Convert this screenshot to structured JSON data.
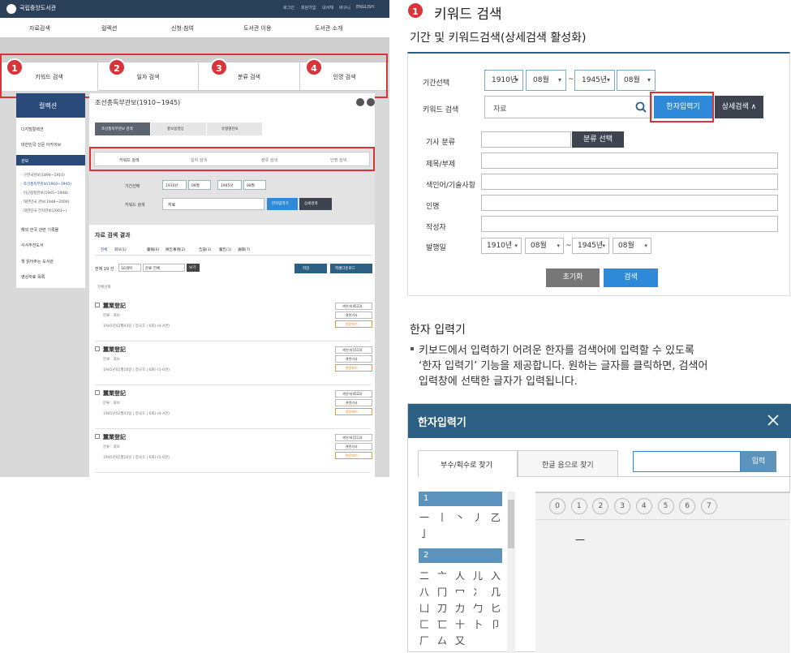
{
  "left_shot": {
    "brand": "국립중앙도서관",
    "util": [
      "로그인",
      "회원가입",
      "내서재",
      "바구니",
      "ENGLISH"
    ],
    "gnb": [
      "자료검색",
      "컬렉션",
      "신청·참여",
      "도서관 이용",
      "도서관 소개"
    ],
    "tabs": [
      {
        "num": "1",
        "label": "키워드 검색"
      },
      {
        "num": "2",
        "label": "일자 검색"
      },
      {
        "num": "3",
        "label": "분류 검색"
      },
      {
        "num": "4",
        "label": "인명 검색"
      }
    ],
    "sidebar_title": "컬렉션",
    "page_title": "조선총독부관보(1910~1945)",
    "sidebar_items": [
      "디지털컬렉션",
      "대한민국 신문 아카이브",
      "관보",
      "· 구한국관보(1894~1910)",
      "· 조선총독부관보(1910~1945)",
      "· 미군정청관보(1945~1948)",
      "· 대한민국 관보(1948~2000)",
      "· 대한민국 전자관보(2001~)",
      "해외 한국 관련 기록물",
      "사서추천도서",
      "책 읽어주는 도서관",
      "영상자료 목록"
    ],
    "sub_tabs": [
      "조선총독부관보 검색",
      "홍보용영상",
      "유형별관보"
    ],
    "inner_tabs": [
      "키워드 검색",
      "일자 검색",
      "분류 검색",
      "인명 검색"
    ],
    "period_label": "기간선택",
    "keyword_label": "키워드 검색",
    "year_from": "1910년",
    "month_from": "08월",
    "year_to": "1945년",
    "month_to": "08월",
    "keyword_value": "자료",
    "hanja_button": "한자입력기",
    "detail_button": "상세검색",
    "result_title": "자료 검색 결과",
    "result_tabs": [
      "전체",
      "휘보(1)",
      "彙報(6)",
      "條告事項(2)",
      "告諭(3)",
      "彙告(1)",
      "通牒(7)"
    ],
    "total": "전체 19 건",
    "page_size": "10개씩",
    "sort": "분류 전체",
    "view": "보기",
    "save": "저장",
    "excel": "엑셀다운로드",
    "select_all": "전체선택",
    "records": [
      {
        "title": "蠶業登記",
        "cat": "분류 : 휘보",
        "meta": "1945년02월03일 | 정규호 | 6회(-(4-4면)",
        "badges": [
          "색인어(4523)",
          "관련기사",
          "원문보기"
        ]
      },
      {
        "title": "蠶業登記",
        "cat": "분류 : 휘보",
        "meta": "1945년01월16일 | 정규호 | 6회(-(5-6면)",
        "badges": [
          "색인어(1513)",
          "관련기사",
          "원문보기"
        ]
      },
      {
        "title": "蠶業登記",
        "cat": "분류 : 휘보",
        "meta": "1945년02월03일 | 정규호 | 6회(-(4-4면)",
        "badges": [
          "색인어(4523)",
          "관련기사",
          "원문보기"
        ]
      },
      {
        "title": "蠶業登記",
        "cat": "분류 : 휘보",
        "meta": "1945년01월16일 | 정규호 | 6회(-(5-6면)",
        "badges": [
          "색인어(1513)",
          "관련기사",
          "원문보기"
        ]
      }
    ]
  },
  "section1": {
    "num": "1",
    "title": "키워드 검색",
    "subtitle": "기간 및 키워드검색(상세검색 활성화)"
  },
  "form": {
    "period_label": "기간선택",
    "keyword_label": "키워드 검색",
    "year_from": "1910년",
    "month_from": "08월",
    "sep": "~",
    "year_to": "1945년",
    "month_to": "08월",
    "keyword_value": "자료",
    "hanja_button": "한자입력기",
    "detail_button": "상세검색 ∧",
    "article_cat_label": "기사 분류",
    "cat_select_button": "분류 선택",
    "title_label": "제목/부제",
    "index_label": "색인어/기술사항",
    "person_label": "인명",
    "author_label": "작성자",
    "date_label": "발행일",
    "date_year_from": "1910년",
    "date_month_from": "08월",
    "date_year_to": "1945년",
    "date_month_to": "08월",
    "reset_button": "초기화",
    "search_button": "검색"
  },
  "hanja_section": {
    "title": "한자 입력기",
    "desc1": "키보드에서 입력하기 어려운 한자를 검색어에 입력할 수 있도록",
    "desc2": "‘한자 입력기’ 기능을 제공합니다. 원하는 글자를 클릭하면, 검색어",
    "desc3": "입력창에 선택한 글자가 입력됩니다."
  },
  "hanja_dialog": {
    "title": "한자입력기",
    "tab_radical": "부수/획수로 찾기",
    "tab_hangul": "한글 음으로 찾기",
    "input_button": "입력",
    "group1": "1",
    "group1_chars": [
      "一",
      "丨",
      "丶",
      "丿",
      "乙",
      "亅"
    ],
    "group2": "2",
    "group2_chars": [
      "二",
      "亠",
      "人",
      "儿",
      "入",
      "八",
      "冂",
      "冖",
      "冫",
      "几",
      "凵",
      "刀",
      "力",
      "勹",
      "匕",
      "匚",
      "匸",
      "十",
      "卜",
      "卩",
      "厂",
      "厶",
      "又"
    ],
    "stroke_nums": [
      "0",
      "1",
      "2",
      "3",
      "4",
      "5",
      "6",
      "7"
    ],
    "result_char": "一"
  },
  "colors": {
    "accent": "#2b5f84",
    "red": "#d9343a",
    "blue_btn": "#2e8ad8",
    "dark_btn": "#3d4450"
  }
}
